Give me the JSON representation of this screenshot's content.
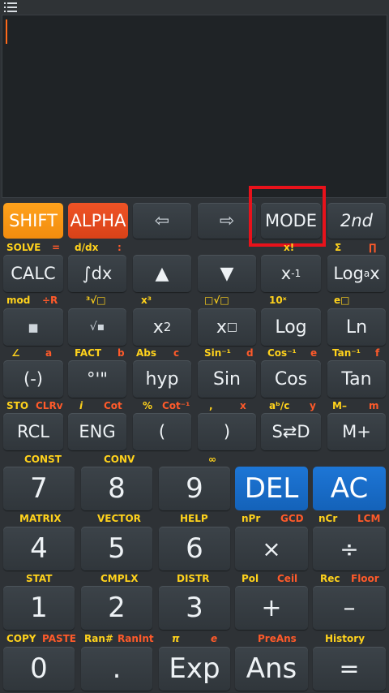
{
  "menu_icon": "hamburger-menu-icon",
  "cursor_color": "#ff6a1a",
  "highlight_color": "#e8121b",
  "row_keys_top": {
    "shift": "SHIFT",
    "alpha": "ALPHA",
    "left": "⇦",
    "right": "⇨",
    "mode": "MODE",
    "second": "2nd"
  },
  "labels_row1": {
    "solve": "SOLVE",
    "eq": "=",
    "ddx": "d/dx",
    "colon": ":",
    "xfact": "x!",
    "sigma": "Σ",
    "pi_prod": "∏"
  },
  "keys_row1": {
    "calc": "CALC",
    "integral": "∫dx",
    "up": "▲",
    "down": "▼",
    "xinv": "x",
    "xinv_sup": "-1",
    "log": "Log",
    "log_sub": "a",
    "log_x": "x"
  },
  "labels_row2": {
    "mod": "mod",
    "divr": "÷R",
    "cbrt": "³√□",
    "x3": "x³",
    "nroot": "□√□",
    "tenx": "10ˣ",
    "ex": "e□"
  },
  "keys_row2": {
    "frac": "▪",
    "sqrt": "√▪",
    "x2": "x",
    "x2_sup": "2",
    "xpow": "x",
    "xpow_sup": "□",
    "log2": "Log",
    "ln": "Ln"
  },
  "labels_row3": {
    "angle": "∠",
    "a": "a",
    "fact": "FACT",
    "b": "b",
    "abs": "Abs",
    "c": "c",
    "asin": "Sin⁻¹",
    "d": "d",
    "acos": "Cos⁻¹",
    "e": "e",
    "atan": "Tan⁻¹",
    "f": "f"
  },
  "keys_row3": {
    "neg": "(-)",
    "dms": "°'\"",
    "hyp": "hyp",
    "sin": "Sin",
    "cos": "Cos",
    "tan": "Tan"
  },
  "labels_row4": {
    "sto": "STO",
    "clrv": "CLRv",
    "i": "i",
    "cot": "Cot",
    "pct": "%",
    "acot": "Cot⁻¹",
    "comma": ",",
    "x": "x",
    "abc": "aᵇ/c",
    "y": "y",
    "mminus": "M–",
    "m": "m"
  },
  "keys_row4": {
    "rcl": "RCL",
    "eng": "ENG",
    "lparen": "(",
    "rparen": ")",
    "sd": "S⇄D",
    "mplus": "M+"
  },
  "labels_row5": {
    "const": "CONST",
    "conv": "CONV",
    "inf": "∞"
  },
  "keys_row5": {
    "k7": "7",
    "k8": "8",
    "k9": "9",
    "del": "DEL",
    "ac": "AC"
  },
  "labels_row6": {
    "matrix": "MATRIX",
    "vector": "VECTOR",
    "help": "HELP",
    "npr": "nPr",
    "gcd": "GCD",
    "ncr": "nCr",
    "lcm": "LCM"
  },
  "keys_row6": {
    "k4": "4",
    "k5": "5",
    "k6": "6",
    "mul": "×",
    "div": "÷"
  },
  "labels_row7": {
    "stat": "STAT",
    "cmplx": "CMPLX",
    "distr": "DISTR",
    "pol": "Pol",
    "ceil": "Ceil",
    "rec": "Rec",
    "floor": "Floor"
  },
  "keys_row7": {
    "k1": "1",
    "k2": "2",
    "k3": "3",
    "plus": "+",
    "minus": "–"
  },
  "labels_row8": {
    "copy": "COPY",
    "paste": "PASTE",
    "ran": "Ran#",
    "ranint": "RanInt",
    "pi": "π",
    "e": "e",
    "preans": "PreAns",
    "history": "History"
  },
  "keys_row8": {
    "k0": "0",
    "dot": ".",
    "exp": "Exp",
    "ans": "Ans",
    "eq": "="
  }
}
